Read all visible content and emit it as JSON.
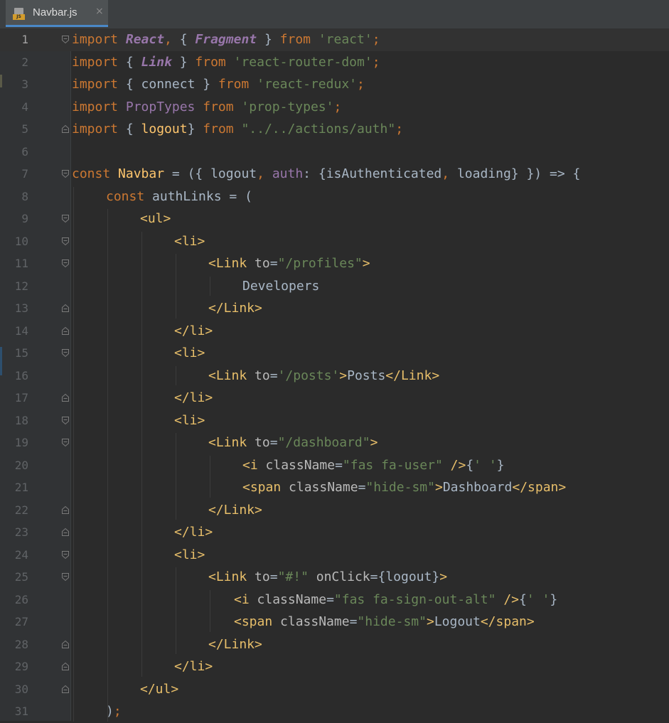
{
  "tab": {
    "filename": "Navbar.js",
    "file_icon_badge": "JS",
    "close_glyph": "×"
  },
  "editor": {
    "current_line": 1,
    "lines": [
      {
        "n": "1",
        "indent": 0,
        "fold": "start",
        "tokens": [
          [
            "kw",
            "import "
          ],
          [
            "clsi",
            "React"
          ],
          [
            "punc",
            ", "
          ],
          [
            "op",
            "{ "
          ],
          [
            "clsi",
            "Fragment"
          ],
          [
            "op",
            " } "
          ],
          [
            "kw",
            "from "
          ],
          [
            "str",
            "'react'"
          ],
          [
            "punc",
            ";"
          ]
        ]
      },
      {
        "n": "2",
        "indent": 0,
        "fold": "",
        "tokens": [
          [
            "kw",
            "import "
          ],
          [
            "op",
            "{ "
          ],
          [
            "clsi",
            "Link"
          ],
          [
            "op",
            " } "
          ],
          [
            "kw",
            "from "
          ],
          [
            "str",
            "'react-router-dom'"
          ],
          [
            "punc",
            ";"
          ]
        ]
      },
      {
        "n": "3",
        "indent": 0,
        "fold": "",
        "tokens": [
          [
            "kw",
            "import "
          ],
          [
            "op",
            "{ "
          ],
          [
            "id",
            "connect"
          ],
          [
            "op",
            " } "
          ],
          [
            "kw",
            "from "
          ],
          [
            "str",
            "'react-redux'"
          ],
          [
            "punc",
            ";"
          ]
        ]
      },
      {
        "n": "4",
        "indent": 0,
        "fold": "",
        "tokens": [
          [
            "kw",
            "import "
          ],
          [
            "cls",
            "PropTypes "
          ],
          [
            "kw",
            "from "
          ],
          [
            "str",
            "'prop-types'"
          ],
          [
            "punc",
            ";"
          ]
        ]
      },
      {
        "n": "5",
        "indent": 0,
        "fold": "end",
        "tokens": [
          [
            "kw",
            "import "
          ],
          [
            "op",
            "{ "
          ],
          [
            "fn",
            "logout"
          ],
          [
            "op",
            "} "
          ],
          [
            "kw",
            "from "
          ],
          [
            "str",
            "\"../../actions/auth\""
          ],
          [
            "punc",
            ";"
          ]
        ]
      },
      {
        "n": "6",
        "indent": 0,
        "fold": "",
        "tokens": []
      },
      {
        "n": "7",
        "indent": 0,
        "fold": "start",
        "tokens": [
          [
            "kw",
            "const "
          ],
          [
            "fn",
            "Navbar"
          ],
          [
            "op",
            " = ({ "
          ],
          [
            "id",
            "logout"
          ],
          [
            "punc",
            ", "
          ],
          [
            "prop",
            "auth"
          ],
          [
            "op",
            ": {"
          ],
          [
            "id",
            "isAuthenticated"
          ],
          [
            "punc",
            ", "
          ],
          [
            "id",
            "loading"
          ],
          [
            "op",
            "} }) => {"
          ]
        ]
      },
      {
        "n": "8",
        "indent": 1,
        "fold": "",
        "tokens": [
          [
            "kw",
            "const "
          ],
          [
            "id",
            "authLinks"
          ],
          [
            "op",
            " = ("
          ]
        ]
      },
      {
        "n": "9",
        "indent": 2,
        "fold": "start",
        "tokens": [
          [
            "tag",
            "<ul"
          ],
          [
            "tag",
            ">"
          ]
        ]
      },
      {
        "n": "10",
        "indent": 3,
        "fold": "start",
        "tokens": [
          [
            "tag",
            "<li>"
          ]
        ]
      },
      {
        "n": "11",
        "indent": 4,
        "fold": "start",
        "tokens": [
          [
            "tag",
            "<Link "
          ],
          [
            "attr",
            "to"
          ],
          [
            "op",
            "="
          ],
          [
            "str",
            "\"/profiles\""
          ],
          [
            "tag",
            ">"
          ]
        ]
      },
      {
        "n": "12",
        "indent": 5,
        "fold": "",
        "tokens": [
          [
            "txt",
            "Developers"
          ]
        ]
      },
      {
        "n": "13",
        "indent": 4,
        "fold": "end",
        "tokens": [
          [
            "tag",
            "</Link>"
          ]
        ]
      },
      {
        "n": "14",
        "indent": 3,
        "fold": "end",
        "tokens": [
          [
            "tag",
            "</li>"
          ]
        ]
      },
      {
        "n": "15",
        "indent": 3,
        "fold": "start",
        "tokens": [
          [
            "tag",
            "<li>"
          ]
        ]
      },
      {
        "n": "16",
        "indent": 4,
        "fold": "",
        "tokens": [
          [
            "tag",
            "<Link "
          ],
          [
            "attr",
            "to"
          ],
          [
            "op",
            "="
          ],
          [
            "str",
            "'/posts'"
          ],
          [
            "tag",
            ">"
          ],
          [
            "txt",
            "Posts"
          ],
          [
            "tag",
            "</Link>"
          ]
        ]
      },
      {
        "n": "17",
        "indent": 3,
        "fold": "end",
        "tokens": [
          [
            "tag",
            "</li>"
          ]
        ]
      },
      {
        "n": "18",
        "indent": 3,
        "fold": "start",
        "tokens": [
          [
            "tag",
            "<li>"
          ]
        ]
      },
      {
        "n": "19",
        "indent": 4,
        "fold": "start",
        "tokens": [
          [
            "tag",
            "<Link "
          ],
          [
            "attr",
            "to"
          ],
          [
            "op",
            "="
          ],
          [
            "str",
            "\"/dashboard\""
          ],
          [
            "tag",
            ">"
          ]
        ]
      },
      {
        "n": "20",
        "indent": 5,
        "fold": "",
        "tokens": [
          [
            "tag",
            "<i "
          ],
          [
            "attr",
            "className"
          ],
          [
            "op",
            "="
          ],
          [
            "str",
            "\"fas fa-user\""
          ],
          [
            "tag",
            " />"
          ],
          [
            "op",
            "{"
          ],
          [
            "str",
            "' '"
          ],
          [
            "op",
            "}"
          ]
        ]
      },
      {
        "n": "21",
        "indent": 5,
        "fold": "",
        "tokens": [
          [
            "tag",
            "<span "
          ],
          [
            "attr",
            "className"
          ],
          [
            "op",
            "="
          ],
          [
            "str",
            "\"hide-sm\""
          ],
          [
            "tag",
            ">"
          ],
          [
            "txt",
            "Dashboard"
          ],
          [
            "tag",
            "</span>"
          ]
        ]
      },
      {
        "n": "22",
        "indent": 4,
        "fold": "end",
        "tokens": [
          [
            "tag",
            "</Link>"
          ]
        ]
      },
      {
        "n": "23",
        "indent": 3,
        "fold": "end",
        "tokens": [
          [
            "tag",
            "</li>"
          ]
        ]
      },
      {
        "n": "24",
        "indent": 3,
        "fold": "start",
        "tokens": [
          [
            "tag",
            "<li>"
          ]
        ]
      },
      {
        "n": "25",
        "indent": 4,
        "fold": "start",
        "tokens": [
          [
            "tag",
            "<Link "
          ],
          [
            "attr",
            "to"
          ],
          [
            "op",
            "="
          ],
          [
            "str",
            "\"#!\""
          ],
          [
            "attr",
            " onClick"
          ],
          [
            "op",
            "={"
          ],
          [
            "id",
            "logout"
          ],
          [
            "op",
            "}"
          ],
          [
            "tag",
            ">"
          ]
        ]
      },
      {
        "n": "26",
        "indent": 4.75,
        "fold": "",
        "tokens": [
          [
            "tag",
            "<i "
          ],
          [
            "attr",
            "className"
          ],
          [
            "op",
            "="
          ],
          [
            "str",
            "\"fas fa-sign-out-alt\""
          ],
          [
            "tag",
            " />"
          ],
          [
            "op",
            "{"
          ],
          [
            "str",
            "' '"
          ],
          [
            "op",
            "}"
          ]
        ]
      },
      {
        "n": "27",
        "indent": 4.75,
        "fold": "",
        "tokens": [
          [
            "tag",
            "<span "
          ],
          [
            "attr",
            "className"
          ],
          [
            "op",
            "="
          ],
          [
            "str",
            "\"hide-sm\""
          ],
          [
            "tag",
            ">"
          ],
          [
            "txt",
            "Logout"
          ],
          [
            "tag",
            "</span>"
          ]
        ]
      },
      {
        "n": "28",
        "indent": 4,
        "fold": "end",
        "tokens": [
          [
            "tag",
            "</Link>"
          ]
        ]
      },
      {
        "n": "29",
        "indent": 3,
        "fold": "end",
        "tokens": [
          [
            "tag",
            "</li>"
          ]
        ]
      },
      {
        "n": "30",
        "indent": 2,
        "fold": "end",
        "tokens": [
          [
            "tag",
            "</ul>"
          ]
        ]
      },
      {
        "n": "31",
        "indent": 1,
        "fold": "",
        "tokens": [
          [
            "op",
            ")"
          ],
          [
            "punc",
            ";"
          ]
        ]
      }
    ]
  }
}
